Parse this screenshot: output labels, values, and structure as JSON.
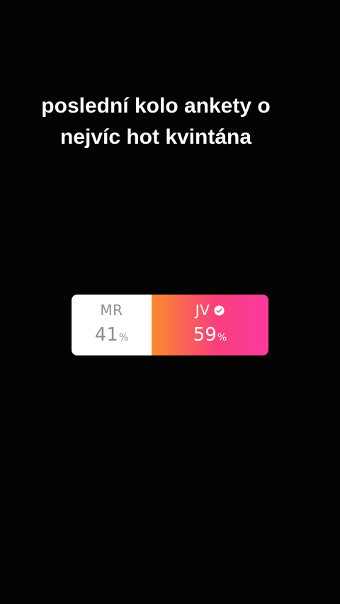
{
  "caption": {
    "line1": "poslední kolo ankety o",
    "line2": "nejvíc hot kvintána"
  },
  "poll": {
    "options": [
      {
        "label": "MR",
        "percent": "41",
        "percent_sign": "%",
        "selected": false
      },
      {
        "label": "JV",
        "percent": "59",
        "percent_sign": "%",
        "selected": true,
        "icon": "check-circle-icon"
      }
    ]
  }
}
